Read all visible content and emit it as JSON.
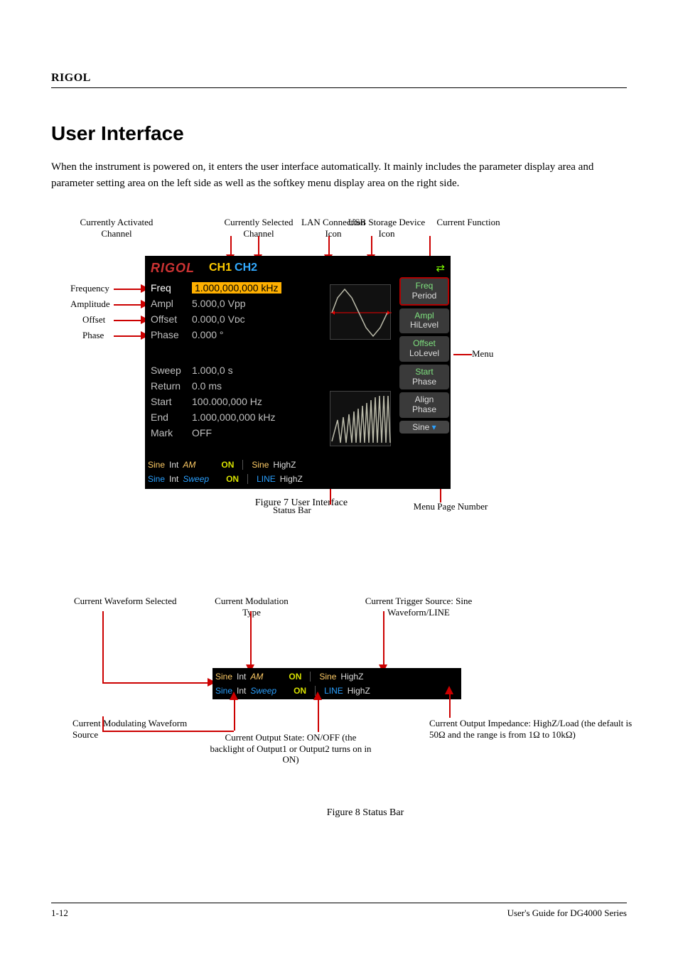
{
  "header": {
    "brand": "RIGOL"
  },
  "title": "User Interface",
  "intro": "When the instrument is powered on, it enters the user interface automatically. It mainly includes the parameter display area and parameter setting area on the left side as well as the softkey menu display area on the right side.",
  "fig1_caption": "Figure 7 User Interface",
  "fig2_caption": "Figure 8 Status Bar",
  "footer": {
    "page": "1-12",
    "title": "User's Guide for DG4000 Series"
  },
  "device": {
    "brand": "RIGOL",
    "ch1": "CH1",
    "ch2": "CH2",
    "usb_icon": "usb-icon",
    "params": [
      {
        "label": "Freq",
        "value": "1.000,000,000 kHz",
        "active": true
      },
      {
        "label": "Ampl",
        "value": "5.000,0 Vpp"
      },
      {
        "label": "Offset",
        "value": "0.000,0 Vᴅᴄ"
      },
      {
        "label": "Phase",
        "value": "0.000 °"
      }
    ],
    "sweep": [
      {
        "label": "Sweep",
        "value": "1.000,0 s"
      },
      {
        "label": "Return",
        "value": "0.0 ms"
      },
      {
        "label": "Start",
        "value": "100.000,000 Hz"
      },
      {
        "label": "End",
        "value": "1.000,000,000 kHz"
      },
      {
        "label": "Mark",
        "value": "OFF"
      }
    ],
    "softkeys": [
      {
        "line1": "Freq",
        "line2": "Period",
        "sel": 1,
        "active": true
      },
      {
        "line1": "Ampl",
        "line2": "HiLevel",
        "sel": 1
      },
      {
        "line1": "Offset",
        "line2": "LoLevel",
        "sel": 1
      },
      {
        "line1": "Start",
        "line2": "Phase",
        "sel": 1
      },
      {
        "line1": "Align",
        "line2": "Phase",
        "sel": 0
      }
    ],
    "last_softkey": {
      "label": "Sine",
      "arrow": "▾"
    }
  },
  "status_bar": {
    "ch1": {
      "wave": "Sine",
      "src": "Int",
      "mod": "AM",
      "on": "ON",
      "trig_wave": "Sine",
      "imp": "HighZ"
    },
    "ch2": {
      "wave": "Sine",
      "src": "Int",
      "mod": "Sweep",
      "on": "ON",
      "trig_wave": "LINE",
      "imp": "HighZ"
    }
  },
  "fig1_callouts": {
    "freq": "Frequency",
    "ampl": "Amplitude",
    "offs": "Offset",
    "phase": "Phase",
    "ch_active": "Currently Activated Channel",
    "ch_select": "Currently Selected Channel",
    "lan": "LAN Connection Icon",
    "usb": "USB Storage Device Icon",
    "current_fn": "Current Function",
    "menu": "Menu",
    "menu_page": "Menu Page Number",
    "status_bar": "Status Bar"
  },
  "fig2_callouts": {
    "wave_sel": "Current Waveform Selected",
    "mod_src": "Current Modulating Waveform Source",
    "mod_type": "Current Modulation Type",
    "output_state": "Current Output State: ON/OFF (the backlight of Output1 or Output2 turns on in ON)",
    "trig_src": "Current Trigger Source: Sine Waveform/LINE",
    "output_imp": "Current Output Impedance: HighZ/Load (the default is 50Ω and the range is from 1Ω to 10kΩ)"
  }
}
